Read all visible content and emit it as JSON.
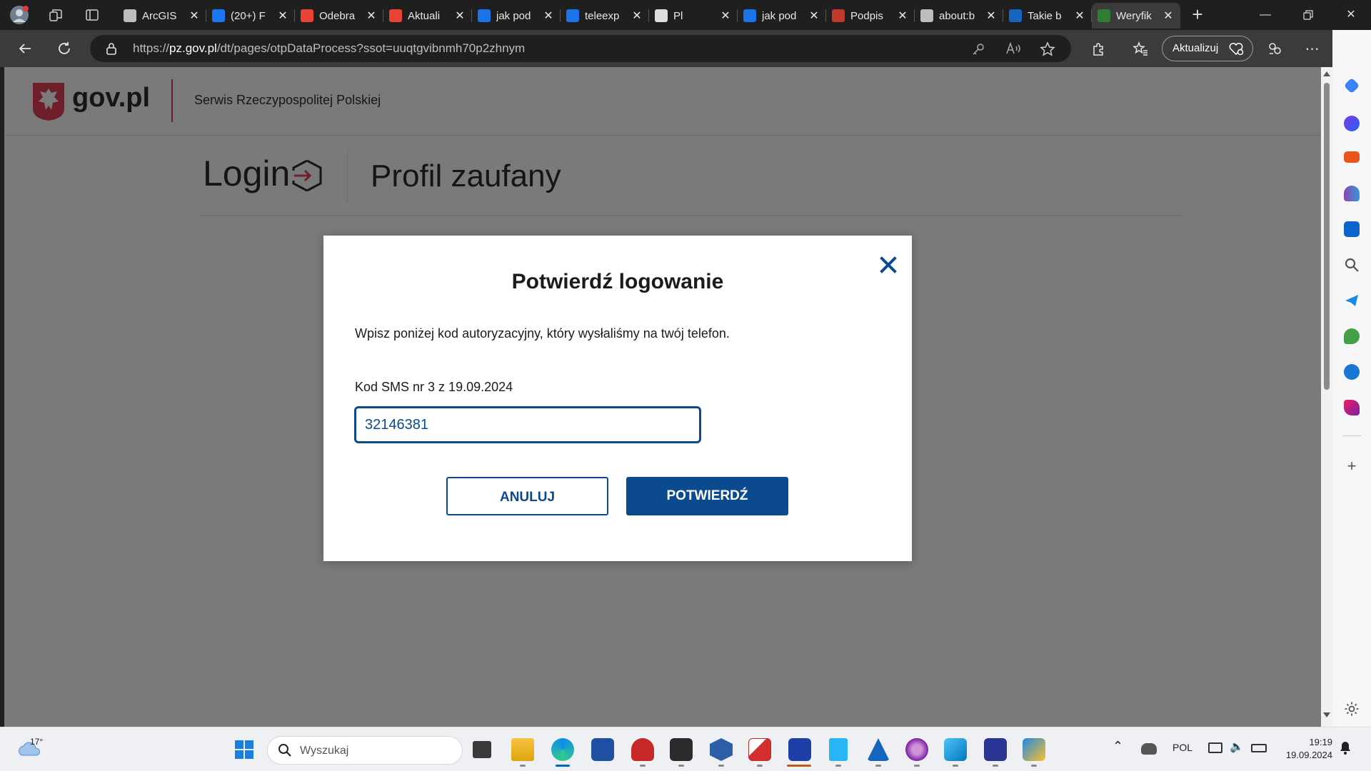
{
  "browser": {
    "tabs": [
      {
        "title": "ArcGIS",
        "favicon": "doc-icon",
        "color": "#bdbdbd"
      },
      {
        "title": "(20+) F",
        "favicon": "facebook-icon",
        "color": "#1877f2"
      },
      {
        "title": "Odebra",
        "favicon": "gmail-icon",
        "color": "#ea4335"
      },
      {
        "title": "Aktuali",
        "favicon": "gmail-icon",
        "color": "#ea4335"
      },
      {
        "title": "jak pod",
        "favicon": "search-icon",
        "color": "#1a73e8"
      },
      {
        "title": "teleexp",
        "favicon": "search-icon",
        "color": "#1a73e8"
      },
      {
        "title": "Pl",
        "favicon": "audio-icon",
        "color": "#dddddd"
      },
      {
        "title": "jak pod",
        "favicon": "search-icon",
        "color": "#1a73e8"
      },
      {
        "title": "Podpis",
        "favicon": "eagle-icon",
        "color": "#c0392b"
      },
      {
        "title": "about:b",
        "favicon": "doc-icon",
        "color": "#bdbdbd"
      },
      {
        "title": "Takie b",
        "favicon": "gk-icon",
        "color": "#1565c0"
      },
      {
        "title": "Weryfik",
        "favicon": "govpl-icon",
        "color": "#2e7d32"
      }
    ],
    "url_prefix": "https://",
    "url_domain": "pz.gov.pl",
    "url_path": "/dt/pages/otpDataProcess?ssot=uuqtgvibnmh70p2zhnym",
    "update_label": "Aktualizuj"
  },
  "page": {
    "logo_text": "gov.pl",
    "header_subtitle": "Serwis Rzeczypospolitej Polskiej",
    "login_title": "Login",
    "profile_title": "Profil zaufany"
  },
  "modal": {
    "title": "Potwierdź logowanie",
    "description": "Wpisz poniżej kod autoryzacyjny, który wysłaliśmy na twój telefon.",
    "sms_label": "Kod SMS nr 3 z 19.09.2024",
    "sms_value": "32146381",
    "cancel_label": "ANULUJ",
    "confirm_label": "POTWIERDŹ",
    "accent": "#0b4a8f"
  },
  "taskbar": {
    "temperature": "17°",
    "search_placeholder": "Wyszukaj",
    "language": "POL",
    "time": "19:19",
    "date": "19.09.2024"
  }
}
